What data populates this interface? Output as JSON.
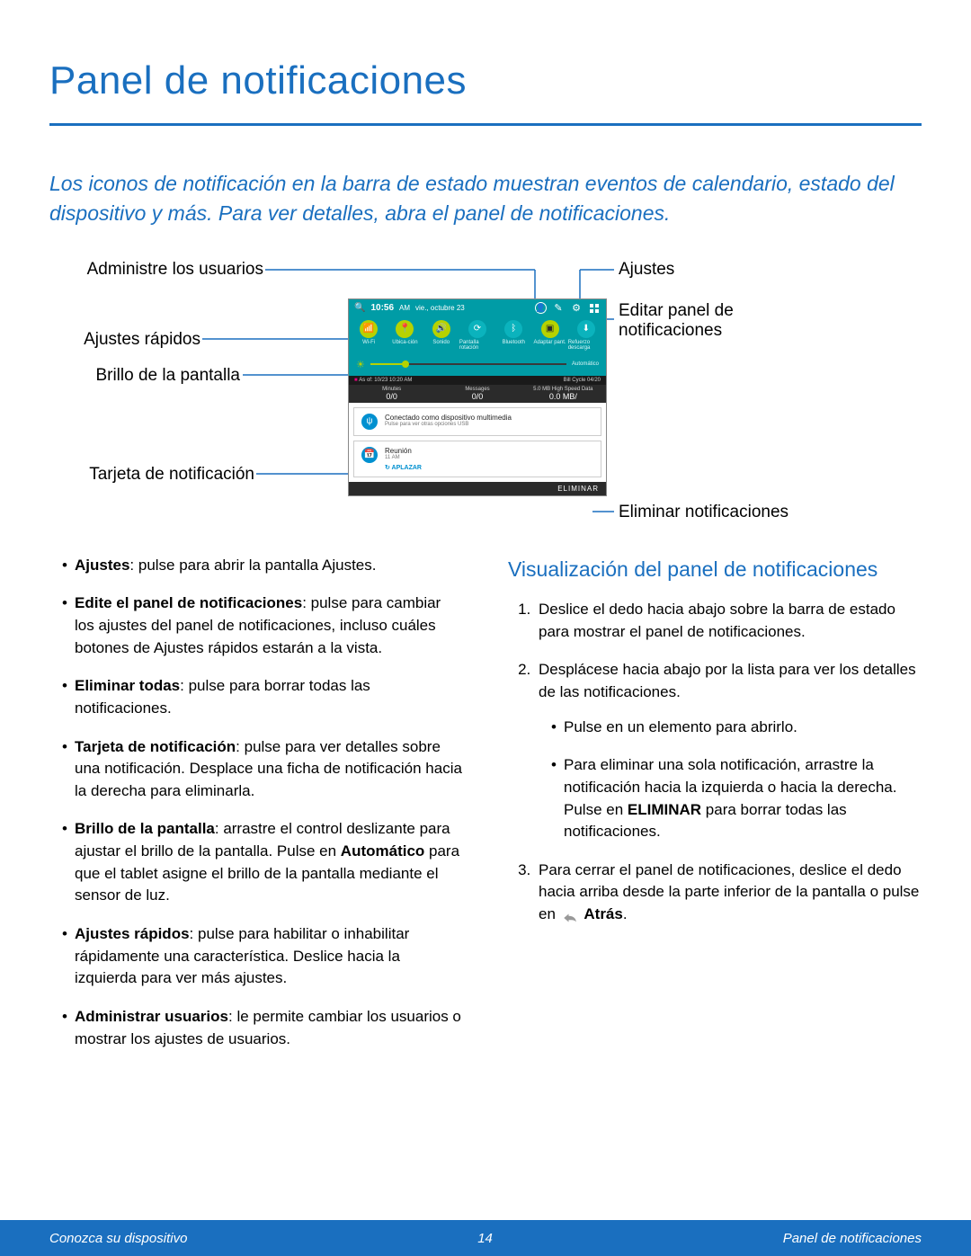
{
  "title": "Panel de notificaciones",
  "intro": "Los iconos de notificación en la barra de estado muestran eventos de calendario, estado del dispositivo y más. Para ver detalles, abra el panel de notificaciones.",
  "callouts": {
    "manage_users": "Administre los usuarios",
    "quick_settings": "Ajustes rápidos",
    "brightness": "Brillo de la pantalla",
    "notification_card": "Tarjeta de notificación",
    "settings": "Ajustes",
    "edit_panel": "Editar panel de notificaciones",
    "clear_notifications": "Eliminar notificaciones"
  },
  "phone": {
    "time": "10:56",
    "ampm": "AM",
    "date": "vie., octubre 23",
    "qs": [
      "Wi-Fi",
      "Ubica-ción",
      "Sonido",
      "Pantalla rotación",
      "Bluetooth",
      "Adaptar pant.",
      "Refuerzo descarga"
    ],
    "auto": "Automático",
    "strip_left": "As of: 10/23 10:20 AM",
    "strip_right": "Bill Cycle 04/20",
    "usage": {
      "minutes_label": "Minutes",
      "minutes_val": "0/0",
      "messages_label": "Messages",
      "messages_val": "0/0",
      "data_label": "5.0 MB High Speed Data",
      "data_val": "0.0 MB/"
    },
    "card_usb_t1": "Conectado como dispositivo multimedia",
    "card_usb_t2": "Pulse para ver otras opciones USB",
    "card_cal_t1": "Reunión",
    "card_cal_t2": "11 AM",
    "card_cal_action": "↻ APLAZAR",
    "eliminar": "ELIMINAR"
  },
  "bullets": [
    {
      "b": "Ajustes",
      "t": ": pulse para abrir la pantalla Ajustes."
    },
    {
      "b": "Edite el panel de notificaciones",
      "t": ": pulse para cambiar los ajustes del panel de notificaciones, incluso cuáles botones de Ajustes rápidos estarán a la vista."
    },
    {
      "b": "Eliminar todas",
      "t": ": pulse para borrar todas las notificaciones."
    },
    {
      "b": "Tarjeta de notificación",
      "t": ": pulse para ver detalles sobre una notificación. Desplace una ficha de notificación hacia la derecha para eliminarla."
    },
    {
      "b": "Brillo de la pantalla",
      "t": ": arrastre el control deslizante para ajustar el brillo de la pantalla. Pulse en ",
      "b2": "Automático",
      "t2": " para que el tablet asigne el brillo de la pantalla mediante el sensor de luz."
    },
    {
      "b": "Ajustes rápidos",
      "t": ": pulse para habilitar o inhabilitar rápidamente una característica. Deslice hacia la izquierda para ver más ajustes."
    },
    {
      "b": "Administrar usuarios",
      "t": ": le permite cambiar los usuarios o mostrar los ajustes de usuarios."
    }
  ],
  "subheading": "Visualización del panel de notificaciones",
  "steps": {
    "s1": "Deslice el dedo hacia abajo sobre la barra de estado para mostrar el panel de notificaciones.",
    "s2": "Desplácese hacia abajo por la lista para ver los detalles de las notificaciones.",
    "s2a": "Pulse en un elemento para abrirlo.",
    "s2b_pre": "Para eliminar una sola notificación, arrastre la notificación hacia la izquierda o hacia la derecha. Pulse en ",
    "s2b_bold": "ELIMINAR",
    "s2b_post": " para borrar todas las notificaciones.",
    "s3_pre": "Para cerrar el panel de notificaciones, deslice el dedo hacia arriba desde la parte inferior de la pantalla o pulse en ",
    "s3_bold": "Atrás",
    "s3_post": "."
  },
  "footer": {
    "left": "Conozca su dispositivo",
    "page": "14",
    "right": "Panel de notificaciones"
  }
}
